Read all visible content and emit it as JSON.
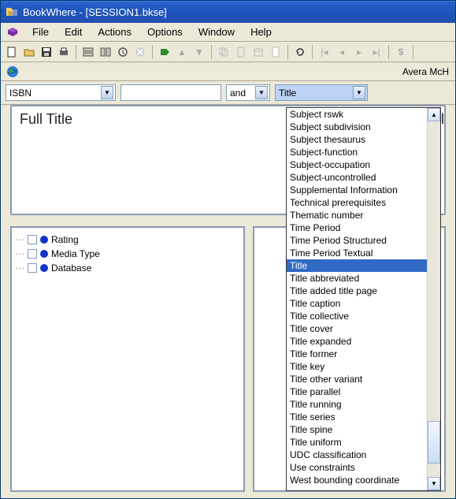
{
  "window": {
    "title": "BookWhere - [SESSION1.bkse]"
  },
  "menu": {
    "items": [
      "File",
      "Edit",
      "Actions",
      "Options",
      "Window",
      "Help"
    ]
  },
  "infobar": {
    "user": "Avera McH"
  },
  "search": {
    "field_combo": "ISBN",
    "input_value": "",
    "operator": "and",
    "field2_combo": "Title"
  },
  "panes": {
    "full_title_header": "Full Title",
    "clipped_right_header": "bli"
  },
  "tree": {
    "items": [
      "Rating",
      "Media Type",
      "Database"
    ]
  },
  "dropdown": {
    "selected": "Title",
    "options": [
      "Subject rswk",
      "Subject subdivision",
      "Subject thesaurus",
      "Subject-function",
      "Subject-occupation",
      "Subject-uncontrolled",
      "Supplemental Information",
      "Technical prerequisites",
      "Thematic number",
      "Time Period",
      "Time Period Structured",
      "Time Period Textual",
      "Title",
      "Title abbreviated",
      "Title added title page",
      "Title caption",
      "Title collective",
      "Title cover",
      "Title expanded",
      "Title former",
      "Title key",
      "Title other variant",
      "Title parallel",
      "Title running",
      "Title series",
      "Title spine",
      "Title uniform",
      "UDC classification",
      "Use constraints",
      "West bounding coordinate"
    ]
  }
}
